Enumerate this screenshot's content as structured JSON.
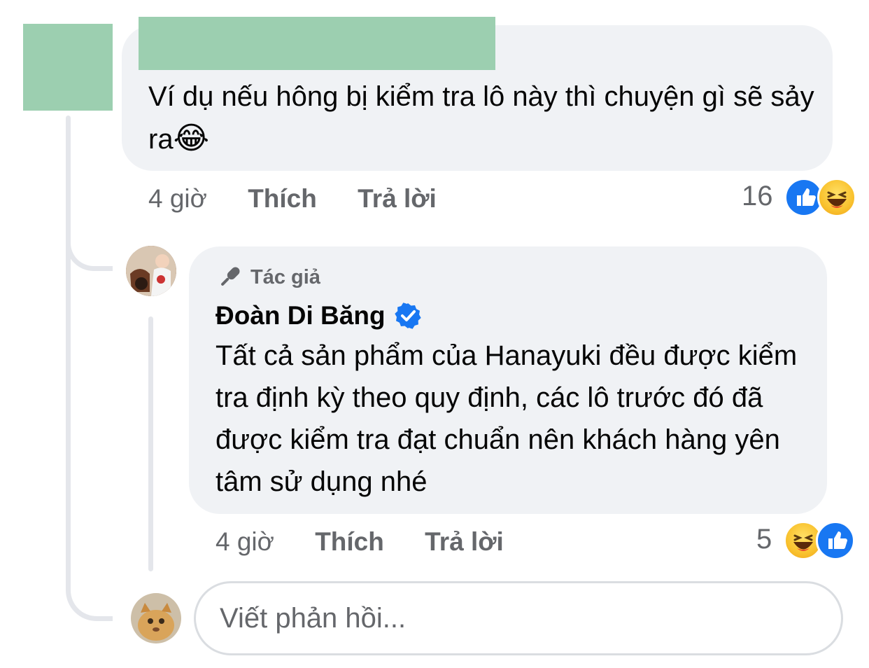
{
  "comment": {
    "text": "Ví dụ nếu hông bị kiểm tra lô này thì chuyện gì sẽ sảy ra",
    "emoji": "😂",
    "time": "4 giờ",
    "like_label": "Thích",
    "reply_label": "Trả lời",
    "reaction_count": "16",
    "reactions": [
      "like-icon",
      "haha-icon"
    ]
  },
  "reply": {
    "badge_label": "Tác giả",
    "author": "Đoàn Di Băng",
    "verified": true,
    "text": "Tất cả sản phẩm của Hanayuki đều được kiểm tra định kỳ theo quy định, các lô trước đó đã được kiểm tra đạt chuẩn nên khách hàng yên tâm sử dụng nhé",
    "time": "4 giờ",
    "like_label": "Thích",
    "reply_label": "Trả lời",
    "reaction_count": "5",
    "reactions": [
      "haha-icon",
      "like-icon"
    ]
  },
  "composer": {
    "placeholder": "Viết phản hồi..."
  },
  "colors": {
    "bubble": "#f0f2f5",
    "muted_text": "#65676b",
    "like_blue": "#1877f2",
    "verified_blue": "#1877f2",
    "redaction": "#9ccfb0"
  }
}
